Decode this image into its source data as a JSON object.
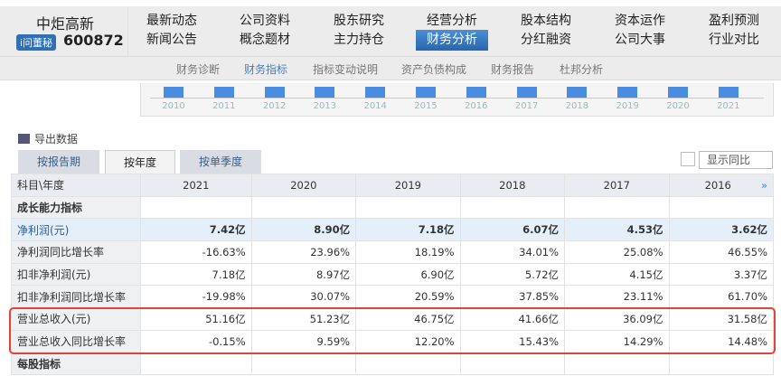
{
  "company": {
    "name": "中炬高新",
    "badge": "i问董秘",
    "code": "600872"
  },
  "nav": {
    "row1": [
      "最新动态",
      "公司资料",
      "股东研究",
      "经营分析",
      "股本结构",
      "资本运作",
      "盈利预测"
    ],
    "row2": [
      "新闻公告",
      "概念题材",
      "主力持仓",
      "财务分析",
      "分红融资",
      "公司大事",
      "行业对比"
    ],
    "active": "财务分析"
  },
  "subnav": [
    "财务诊断",
    "财务指标",
    "指标变动说明",
    "资产负债构成",
    "财务报告",
    "杜邦分析"
  ],
  "chart_years": [
    "2010",
    "2011",
    "2012",
    "2013",
    "2014",
    "2015",
    "2016",
    "2017",
    "2018",
    "2019",
    "2020",
    "2021"
  ],
  "export_label": "导出数据",
  "tabs": [
    "按报告期",
    "按年度",
    "按单季度"
  ],
  "show_yoy": "显示同比",
  "table": {
    "header": [
      "科目\\年度",
      "2021",
      "2020",
      "2019",
      "2018",
      "2017",
      "2016"
    ],
    "more": "»",
    "rows": [
      [
        "成长能力指标",
        "",
        "",
        "",
        "",
        "",
        ""
      ],
      [
        "净利润(元)",
        "7.42亿",
        "8.90亿",
        "7.18亿",
        "6.07亿",
        "4.53亿",
        "3.62亿"
      ],
      [
        "净利润同比增长率",
        "-16.63%",
        "23.96%",
        "18.19%",
        "34.01%",
        "25.08%",
        "46.55%"
      ],
      [
        "扣非净利润(元)",
        "7.18亿",
        "8.97亿",
        "6.90亿",
        "5.72亿",
        "4.15亿",
        "3.37亿"
      ],
      [
        "扣非净利润同比增长率",
        "-19.98%",
        "30.07%",
        "20.59%",
        "37.85%",
        "23.11%",
        "61.70%"
      ],
      [
        "营业总收入(元)",
        "51.16亿",
        "51.23亿",
        "46.75亿",
        "41.66亿",
        "36.09亿",
        "31.58亿"
      ],
      [
        "营业总收入同比增长率",
        "-0.15%",
        "9.59%",
        "12.20%",
        "15.43%",
        "14.29%",
        "14.48%"
      ],
      [
        "每股指标",
        "",
        "",
        "",
        "",
        "",
        ""
      ]
    ]
  }
}
